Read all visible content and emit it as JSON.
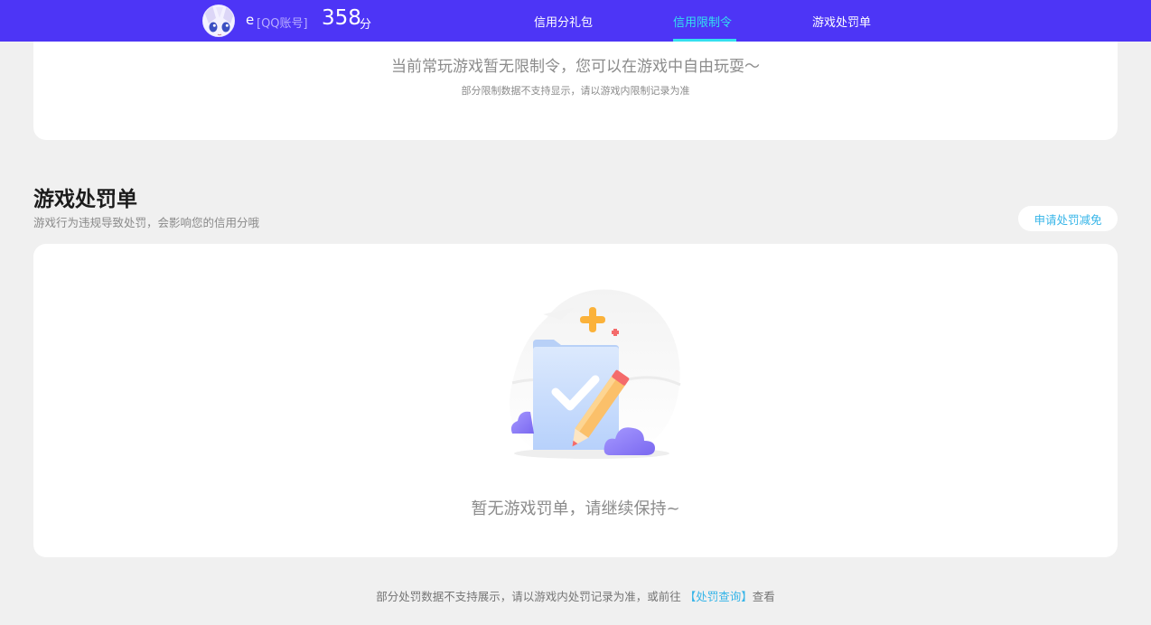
{
  "header": {
    "username": "e",
    "account_type": "[QQ账号]",
    "score": "358",
    "score_unit": "分",
    "tabs": [
      {
        "label": "信用分礼包"
      },
      {
        "label": "信用限制令"
      },
      {
        "label": "游戏处罚单"
      }
    ],
    "active_tab_color": "#34e0ef",
    "bar_color": "#4d35f6"
  },
  "restriction_card": {
    "message": "当前常玩游戏暂无限制令，您可以在游戏中自由玩耍～",
    "note": "部分限制数据不支持显示，请以游戏内限制记录为准"
  },
  "penalty_section": {
    "title": "游戏处罚单",
    "subtitle": "游戏行为违规导致处罚，会影响您的信用分哦",
    "appeal_button": "申请处罚减免",
    "empty_message": "暂无游戏罚单，请继续保持~",
    "illustration_icon": "empty-penalty-folder-pencil-icon"
  },
  "footer": {
    "text_before": "部分处罚数据不支持展示，请以游戏内处罚记录为准，或前往",
    "link_label": "【处罚查询】",
    "text_after": "查看"
  }
}
